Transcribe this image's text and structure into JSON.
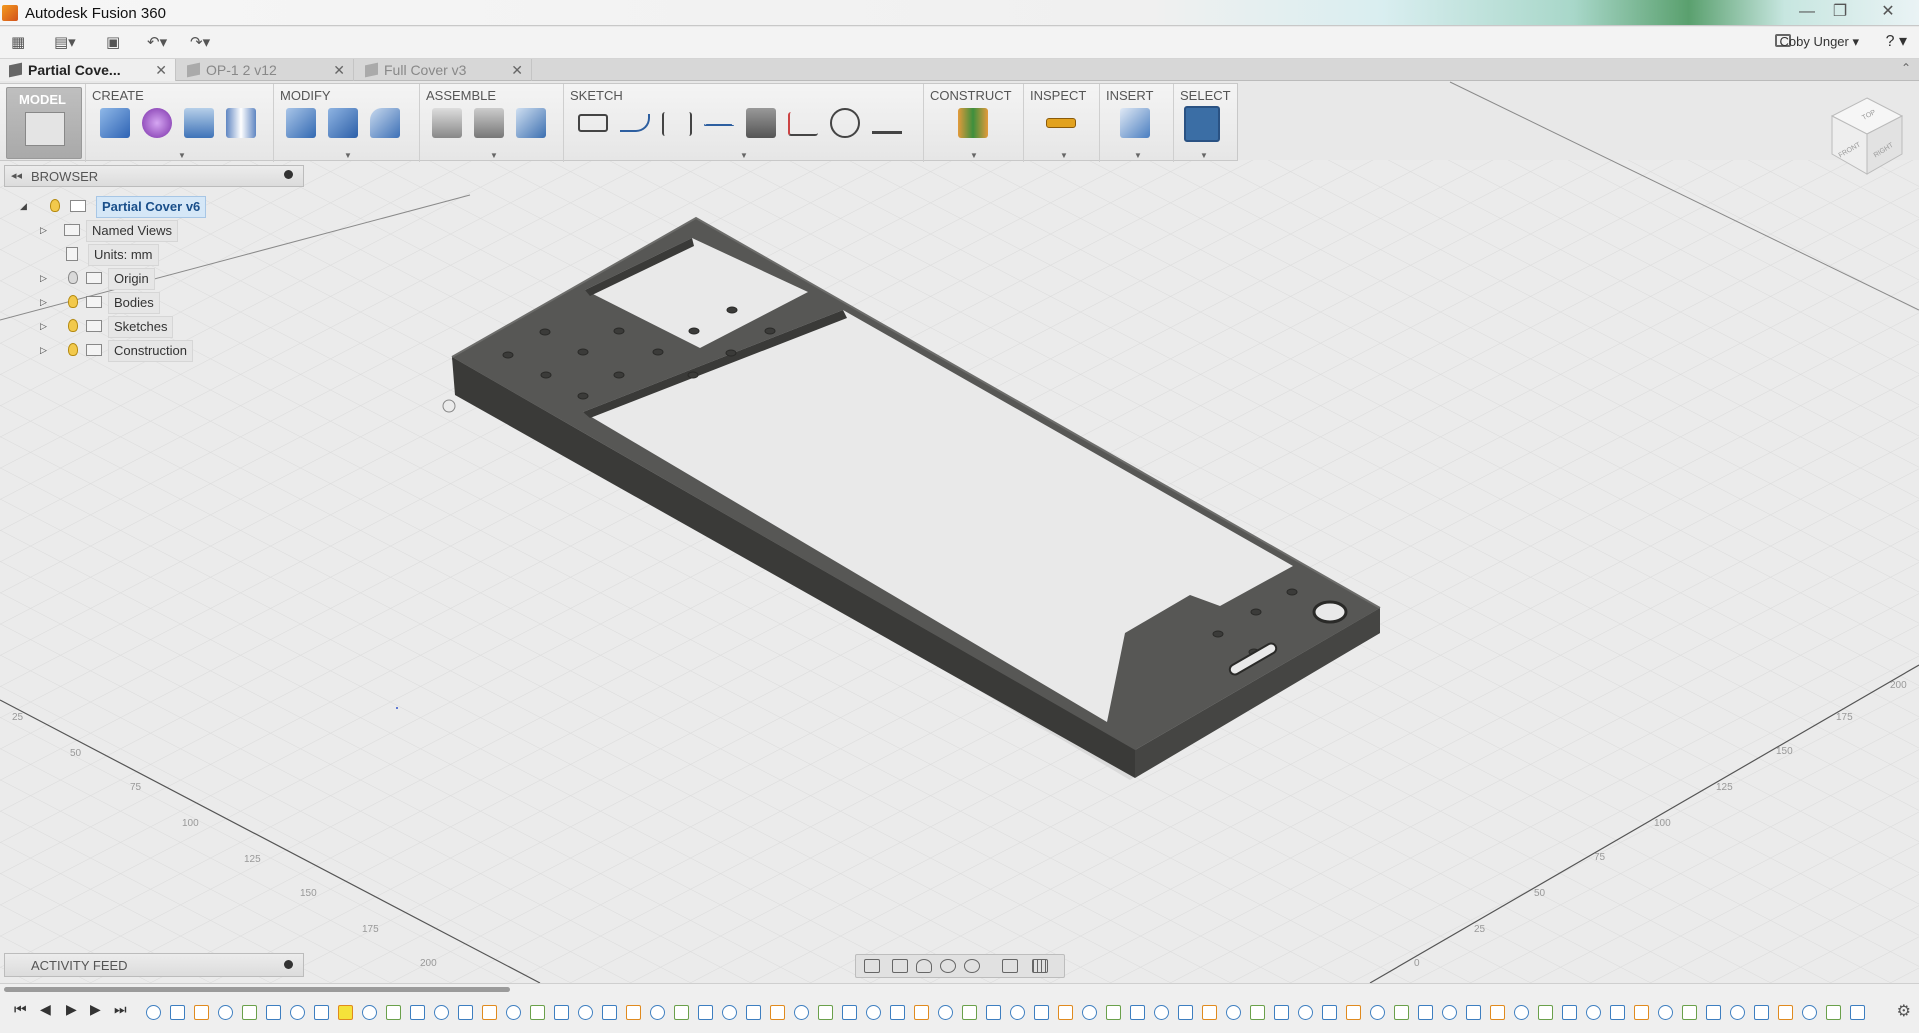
{
  "window": {
    "title": "Autodesk Fusion 360"
  },
  "qat": {
    "user": "Coby Unger ▾",
    "help": "? ▾"
  },
  "tabs": [
    {
      "label": "Partial Cove...",
      "close": "✕"
    },
    {
      "label": "OP-1 2 v12",
      "close": "✕"
    },
    {
      "label": "Full Cover v3",
      "close": "✕"
    }
  ],
  "ribbon": {
    "model": "MODEL",
    "groups": [
      "CREATE",
      "MODIFY",
      "ASSEMBLE",
      "SKETCH",
      "CONSTRUCT",
      "INSPECT",
      "INSERT",
      "SELECT"
    ]
  },
  "browser": {
    "title": "BROWSER",
    "root": "Partial Cover v6",
    "items": [
      "Named Views",
      "Units: mm",
      "Origin",
      "Bodies",
      "Sketches",
      "Construction"
    ]
  },
  "activity": {
    "title": "ACTIVITY FEED"
  },
  "grid": {
    "left_labels": [
      "25",
      "50",
      "75",
      "100",
      "125",
      "150",
      "175",
      "200"
    ],
    "right_labels": [
      "0",
      "25",
      "50",
      "75",
      "100",
      "125",
      "150",
      "175",
      "200"
    ]
  },
  "viewcube": {
    "top": "TOP",
    "front": "FRONT",
    "right": "RIGHT"
  },
  "colors": {
    "accent": "#3d7ec0",
    "body": "#4a4a48",
    "selected_tool": "#3b6ea5"
  }
}
